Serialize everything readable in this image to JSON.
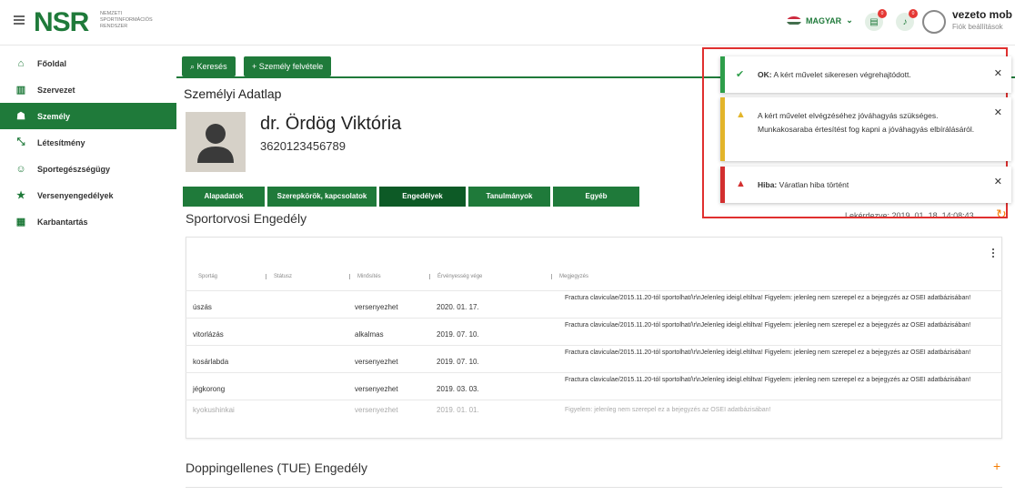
{
  "header": {
    "logo": "NSR",
    "logo_sub_1": "Nemzeti",
    "logo_sub_2": "Sportinformációs",
    "logo_sub_3": "Rendszer",
    "language": "MAGYAR",
    "messages_badge": "0",
    "notifications_badge": "0",
    "user_name": "vezeto mob",
    "user_sub": "Fiók beállítások"
  },
  "sidebar": {
    "items": [
      {
        "label": "Főoldal",
        "icon": "home-icon"
      },
      {
        "label": "Szervezet",
        "icon": "building-icon"
      },
      {
        "label": "Személy",
        "icon": "people-icon"
      },
      {
        "label": "Létesítmény",
        "icon": "arrows-icon"
      },
      {
        "label": "Sportegészségügy",
        "icon": "face-icon"
      },
      {
        "label": "Versenyengedélyek",
        "icon": "star-icon"
      },
      {
        "label": "Karbantartás",
        "icon": "book-icon"
      }
    ]
  },
  "actions": {
    "search": "Keresés",
    "add_person": "Személy felvétele"
  },
  "page": {
    "title": "Személyi Adatlap",
    "person_name": "dr. Ördög Viktória",
    "person_id": "3620123456789"
  },
  "subtabs": [
    "Alapadatok",
    "Szerepkörök, kapcsolatok",
    "Engedélyek",
    "Tanulmányok",
    "Egyéb"
  ],
  "section1": {
    "title": "Sportorvosi Engedély",
    "timestamp": "Lekérdezve: 2019. 01. 18. 14:08:43",
    "columns": [
      "Sportág",
      "Státusz",
      "Minősítés",
      "Érvényesség vége",
      "Megjegyzés"
    ],
    "rows": [
      {
        "sport": "úszás",
        "status": "",
        "rating": "versenyezhet",
        "valid": "2020. 01. 17.",
        "note": "Fractura claviculae/2015.11.20-tól sportolhat/\\r\\nJelenleg ideigl.eltiltva! Figyelem: jelenleg nem szerepel ez a bejegyzés az OSEI adatbázisában!"
      },
      {
        "sport": "vitorlázás",
        "status": "",
        "rating": "alkalmas",
        "valid": "2019. 07. 10.",
        "note": "Fractura claviculae/2015.11.20-tól sportolhat/\\r\\nJelenleg ideigl.eltiltva! Figyelem: jelenleg nem szerepel ez a bejegyzés az OSEI adatbázisában!"
      },
      {
        "sport": "kosárlabda",
        "status": "",
        "rating": "versenyezhet",
        "valid": "2019. 07. 10.",
        "note": "Fractura claviculae/2015.11.20-tól sportolhat/\\r\\nJelenleg ideigl.eltiltva! Figyelem: jelenleg nem szerepel ez a bejegyzés az OSEI adatbázisában!"
      },
      {
        "sport": "jégkorong",
        "status": "",
        "rating": "versenyezhet",
        "valid": "2019. 03. 03.",
        "note": "Fractura claviculae/2015.11.20-tól sportolhat/\\r\\nJelenleg ideigl.eltiltva! Figyelem: jelenleg nem szerepel ez a bejegyzés az OSEI adatbázisában!"
      },
      {
        "sport": "kyokushinkai",
        "status": "",
        "rating": "versenyezhet",
        "valid": "2019. 01. 01.",
        "note": "Figyelem: jelenleg nem szerepel ez a bejegyzés az OSEI adatbázisában!"
      }
    ]
  },
  "section2": {
    "title": "Doppingellenes (TUE) Engedély"
  },
  "toasts": {
    "success_label": "OK:",
    "success_text": "A kért művelet sikeresen végrehajtódott.",
    "warning_text": "A kért művelet elvégzéséhez jóváhagyás szükséges. Munkakosaraba értesítést fog kapni a jóváhagyás elbírálásáról.",
    "error_label": "Hiba:",
    "error_text": "Váratlan hiba történt"
  },
  "colors": {
    "primary": "#1f7a3a",
    "success": "#2e9e4a",
    "warning": "#e3b52a",
    "error": "#d32f2f",
    "accent": "#f57c00"
  }
}
